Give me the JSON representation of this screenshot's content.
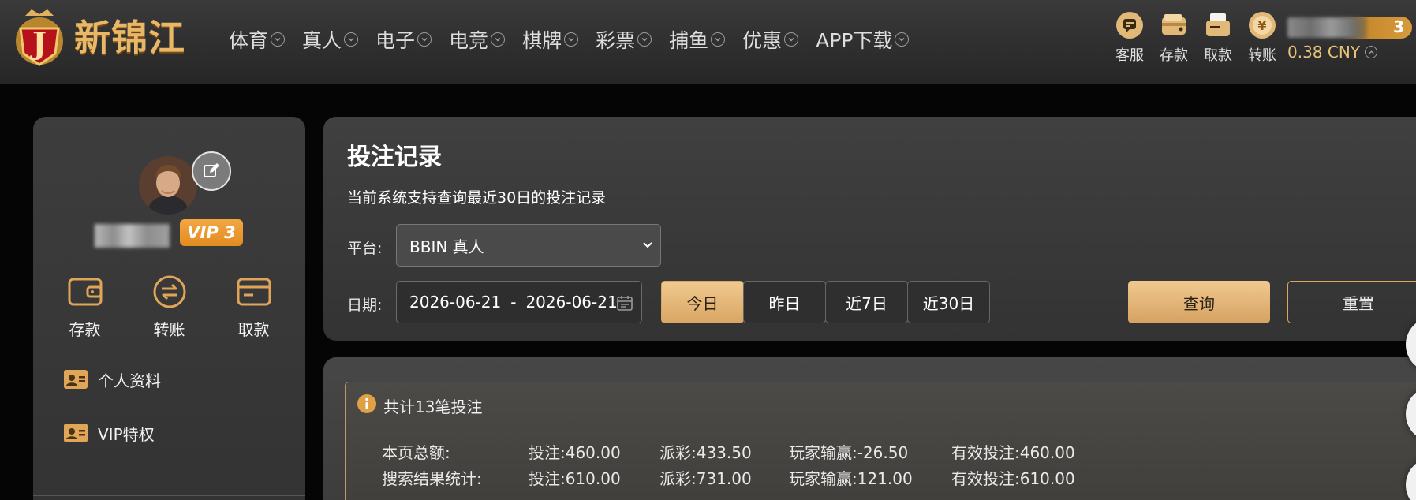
{
  "header": {
    "logo_text": "新锦江",
    "logo_letter": "J",
    "nav": [
      {
        "label": "体育"
      },
      {
        "label": "真人"
      },
      {
        "label": "电子"
      },
      {
        "label": "电竞"
      },
      {
        "label": "棋牌"
      },
      {
        "label": "彩票"
      },
      {
        "label": "捕鱼"
      },
      {
        "label": "优惠"
      },
      {
        "label": "APP下载"
      }
    ],
    "tools": [
      {
        "label": "客服",
        "icon": "customer-service-icon"
      },
      {
        "label": "存款",
        "icon": "deposit-wallet-icon"
      },
      {
        "label": "取款",
        "icon": "withdraw-card-icon"
      },
      {
        "label": "转账",
        "icon": "transfer-coin-icon"
      }
    ],
    "badge_count": "3",
    "balance": "0.38 CNY"
  },
  "sidebar": {
    "vip_label": "VIP 3",
    "quick_actions": [
      {
        "label": "存款",
        "icon": "wallet-icon"
      },
      {
        "label": "转账",
        "icon": "transfer-icon"
      },
      {
        "label": "取款",
        "icon": "card-icon"
      }
    ],
    "menu": [
      {
        "label": "个人资料",
        "icon": "id-card-icon"
      },
      {
        "label": "VIP特权",
        "icon": "id-card-icon"
      }
    ]
  },
  "filter": {
    "title": "投注记录",
    "notice": "当前系统支持查询最近30日的投注记录",
    "platform_label": "平台:",
    "platform_value": "BBIN 真人",
    "date_label": "日期:",
    "date_start": "2026-06-21",
    "date_sep": "-",
    "date_end": "2026-06-21",
    "ranges": [
      {
        "label": "今日",
        "active": true
      },
      {
        "label": "昨日",
        "active": false
      },
      {
        "label": "近7日",
        "active": false
      },
      {
        "label": "近30日",
        "active": false
      }
    ],
    "query_label": "查询",
    "reset_label": "重置"
  },
  "summary": {
    "count_text": "共计13笔投注",
    "rows": [
      {
        "label": "本页总额:",
        "bet": "投注:460.00",
        "payout": "派彩:433.50",
        "win": "玩家输赢:-26.50",
        "valid": "有效投注:460.00"
      },
      {
        "label": "搜索结果统计:",
        "bet": "投注:610.00",
        "payout": "派彩:731.00",
        "win": "玩家输赢:121.00",
        "valid": "有效投注:610.00"
      }
    ]
  },
  "colors": {
    "accent_gold": "#d9a664",
    "vip_orange": "#e8961f",
    "panel_bg": "#3a3a3a",
    "page_bg": "#050505"
  }
}
